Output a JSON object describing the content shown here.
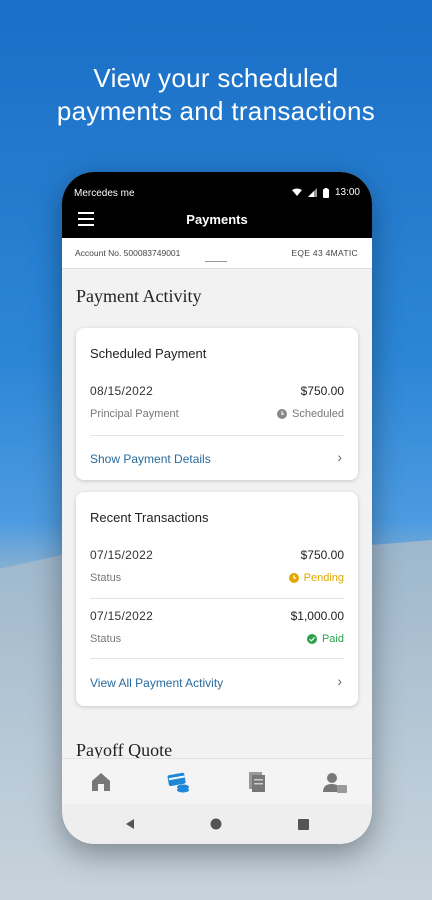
{
  "headline": {
    "line1": "View your scheduled",
    "line2": "payments and transactions"
  },
  "statusbar": {
    "carrier": "Mercedes me",
    "time": "13:00"
  },
  "appbar": {
    "title": "Payments"
  },
  "account": {
    "number": "Account No. 500083749001",
    "model": "EQE 43 4MATIC"
  },
  "payment_activity": {
    "title": "Payment Activity"
  },
  "scheduled": {
    "title": "Scheduled Payment",
    "date": "08/15/2022",
    "amount": "$750.00",
    "type": "Principal Payment",
    "status": "Scheduled",
    "link": "Show Payment Details"
  },
  "recent": {
    "title": "Recent Transactions",
    "items": [
      {
        "date": "07/15/2022",
        "amount": "$750.00",
        "label": "Status",
        "status": "Pending",
        "status_color": "#e0a800"
      },
      {
        "date": "07/15/2022",
        "amount": "$1,000.00",
        "label": "Status",
        "status": "Paid",
        "status_color": "#2aa14a"
      }
    ],
    "link": "View All Payment Activity"
  },
  "payoff": {
    "title": "Payoff Quote"
  },
  "colors": {
    "accent": "#2a6b9e",
    "active_nav": "#1e88d6"
  },
  "bottom_nav_icons": [
    "home-icon",
    "payments-icon",
    "documents-icon",
    "account-icon"
  ]
}
